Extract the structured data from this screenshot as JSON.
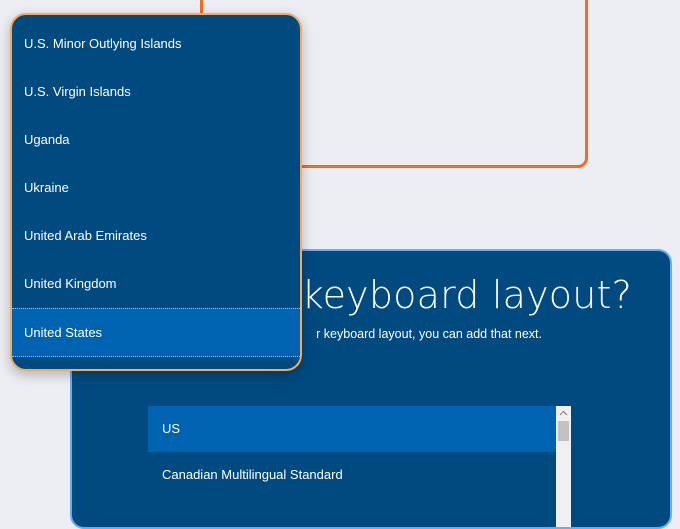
{
  "country_dropdown": {
    "items": [
      {
        "label": "U.S. Minor Outlying Islands",
        "selected": false
      },
      {
        "label": "U.S. Virgin Islands",
        "selected": false
      },
      {
        "label": "Uganda",
        "selected": false
      },
      {
        "label": "Ukraine",
        "selected": false
      },
      {
        "label": "United Arab Emirates",
        "selected": false
      },
      {
        "label": "United Kingdom",
        "selected": false
      },
      {
        "label": "United States",
        "selected": true
      }
    ]
  },
  "keyboard_panel": {
    "title_visible": "ht keyboard layout?",
    "subtitle_visible": "r keyboard layout, you can add that next.",
    "layouts": [
      {
        "label": "US",
        "selected": true
      },
      {
        "label": "Canadian Multilingual Standard",
        "selected": false
      }
    ],
    "scroll_up_icon": "chevron-up-icon"
  },
  "colors": {
    "panel_background": "#004a80",
    "selected_item": "#0063b1",
    "dropdown_border": "#f5a95c",
    "top_card_border": "#f26c1d",
    "panel_border": "#69aef5",
    "page_background": "#eceef3"
  }
}
